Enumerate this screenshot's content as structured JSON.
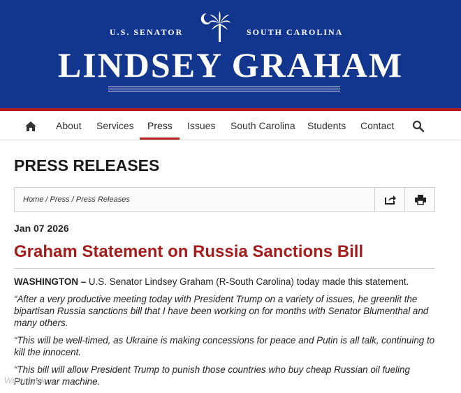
{
  "header": {
    "tag_left": "U.S. SENATOR",
    "tag_right": "SOUTH CAROLINA",
    "name": "LINDSEY GRAHAM",
    "brand_color": "#12358e",
    "accent_color": "#b31b1b",
    "emblem_icon": "palmetto-crescent-icon"
  },
  "nav": {
    "home_icon": "home-icon",
    "items": [
      {
        "label": "About"
      },
      {
        "label": "Services"
      },
      {
        "label": "Press"
      },
      {
        "label": "Issues"
      },
      {
        "label": "South Carolina"
      },
      {
        "label": "Students"
      },
      {
        "label": "Contact"
      }
    ],
    "active": "Press",
    "search_icon": "search-icon"
  },
  "page": {
    "title": "PRESS RELEASES",
    "breadcrumb": "Home / Press / Press Releases",
    "share_icon": "share-icon",
    "print_icon": "print-icon"
  },
  "article": {
    "date": "Jan 07 2026",
    "headline": "Graham Statement on Russia Sanctions Bill",
    "headline_color": "#a51c1c",
    "dateline": "WASHINGTON –",
    "lede": " U.S. Senator Lindsey Graham (R-South Carolina) today made this statement.",
    "paragraphs": [
      "“After a very productive meeting today with President Trump on a variety of issues, he greenlit the bipartisan Russia sanctions bill that I have been working on for months with Senator Blumenthal and many others.",
      "“This will be well-timed, as Ukraine is making concessions for peace and Putin is all talk, continuing to kill the innocent.",
      "“This bill will allow President Trump to punish those countries who buy cheap Russian oil fueling Putin’s war machine."
    ]
  },
  "watermark": "Watermark"
}
